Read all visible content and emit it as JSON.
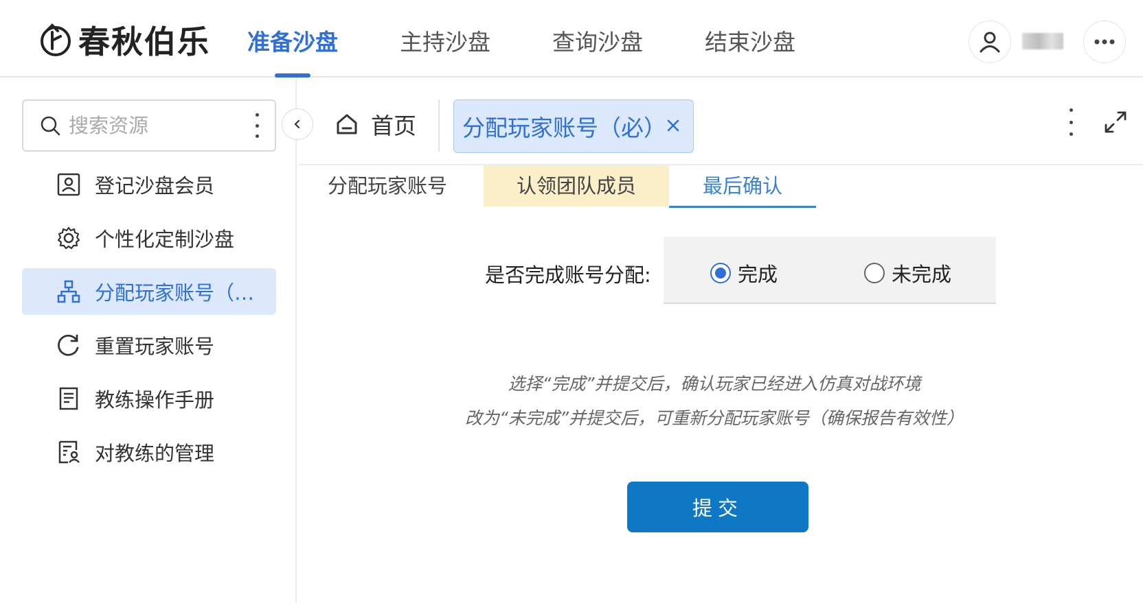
{
  "header": {
    "logo_text": "春秋伯乐",
    "nav": [
      {
        "label": "准备沙盘",
        "active": true
      },
      {
        "label": "主持沙盘",
        "active": false
      },
      {
        "label": "查询沙盘",
        "active": false
      },
      {
        "label": "结束沙盘",
        "active": false
      }
    ],
    "user_name": "■■",
    "more_icon": "more-horizontal-icon"
  },
  "sidebar": {
    "search_placeholder": "搜索资源",
    "items": [
      {
        "label": "登记沙盘会员",
        "icon": "id-card-icon",
        "active": false
      },
      {
        "label": "个性化定制沙盘",
        "icon": "gear-icon",
        "active": false
      },
      {
        "label": "分配玩家账号（必选）",
        "icon": "org-chart-icon",
        "active": true
      },
      {
        "label": "重置玩家账号",
        "icon": "refresh-icon",
        "active": false
      },
      {
        "label": "教练操作手册",
        "icon": "document-icon",
        "active": false
      },
      {
        "label": "对教练的管理",
        "icon": "user-document-icon",
        "active": false
      }
    ]
  },
  "tabs": {
    "home_label": "首页",
    "open_tab_label": "分配玩家账号（必）"
  },
  "steps": [
    {
      "label": "分配玩家账号",
      "state": "done"
    },
    {
      "label": "认领团队成员",
      "state": "highlight"
    },
    {
      "label": "最后确认",
      "state": "active"
    }
  ],
  "form": {
    "label": "是否完成账号分配:",
    "options": [
      {
        "label": "完成",
        "checked": true
      },
      {
        "label": "未完成",
        "checked": false
      }
    ],
    "hint_1": "选择“完成”并提交后，确认玩家已经进入仿真对战环境",
    "hint_2": "改为“未完成”并提交后，可重新分配玩家账号（确保报告有效性）",
    "submit_label": "提交"
  },
  "colors": {
    "accent": "#2f6fd6",
    "active_bg": "#dce8fb",
    "step_highlight": "#fbefc9",
    "submit_bg": "#0f78c4"
  }
}
